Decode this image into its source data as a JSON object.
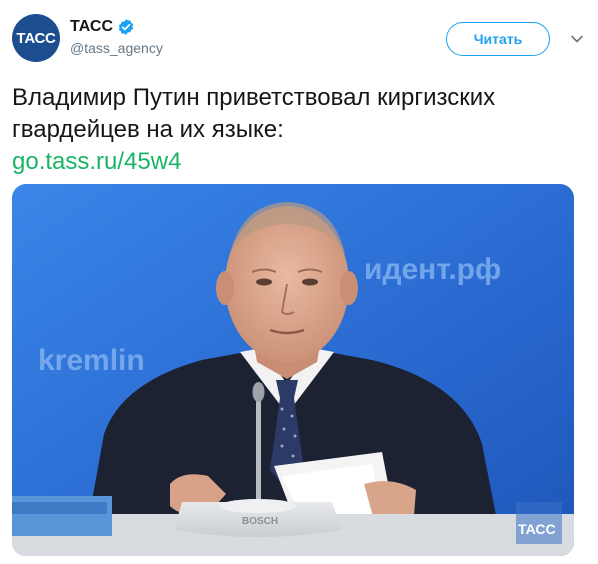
{
  "account": {
    "avatar_text": "ТАСС",
    "name": "ТАСС",
    "handle": "@tass_agency",
    "verified": true
  },
  "actions": {
    "follow_label": "Читать"
  },
  "tweet": {
    "text": "Владимир Путин приветствовал киргизских гвардейцев на их языке:",
    "link": "go.tass.ru/45w4"
  },
  "media": {
    "backdrop_text_left": "kremlin",
    "backdrop_text_right": "идент.рф",
    "mic_brand": "BOSCH",
    "watermark": "ТАСС"
  },
  "colors": {
    "accent": "#1da1f2",
    "link": "#19b564",
    "avatar_bg": "#1c4e8f",
    "photo_bg": "#2a6fd6"
  }
}
